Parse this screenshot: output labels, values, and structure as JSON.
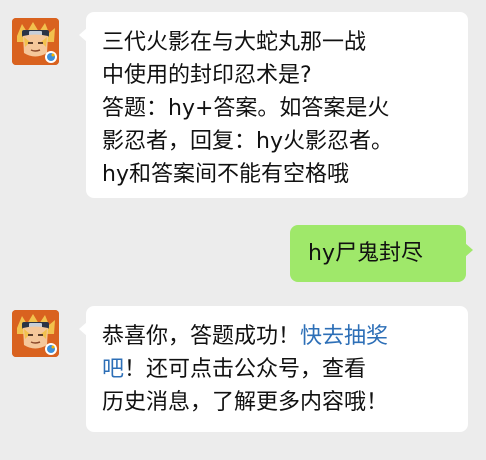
{
  "colors": {
    "background": "#ececec",
    "incoming_bubble": "#ffffff",
    "outgoing_bubble": "#9fe86a",
    "link": "#2d6fb7"
  },
  "messages": [
    {
      "direction": "incoming",
      "lines": [
        "三代火影在与大蛇丸那一战",
        "中使用的封印忍术是?",
        "答题：hy+答案。如答案是火",
        "影忍者，回复：hy火影忍者。",
        "hy和答案间不能有空格哦"
      ]
    },
    {
      "direction": "outgoing",
      "lines": [
        "hy尸鬼封尽"
      ]
    },
    {
      "direction": "incoming",
      "line1_prefix": "恭喜你，答题成功！",
      "line1_link": "快去抽奖",
      "line2_link": "吧",
      "line2_suffix": "！还可点击公众号，查看",
      "line3": "历史消息，了解更多内容哦！"
    }
  ]
}
